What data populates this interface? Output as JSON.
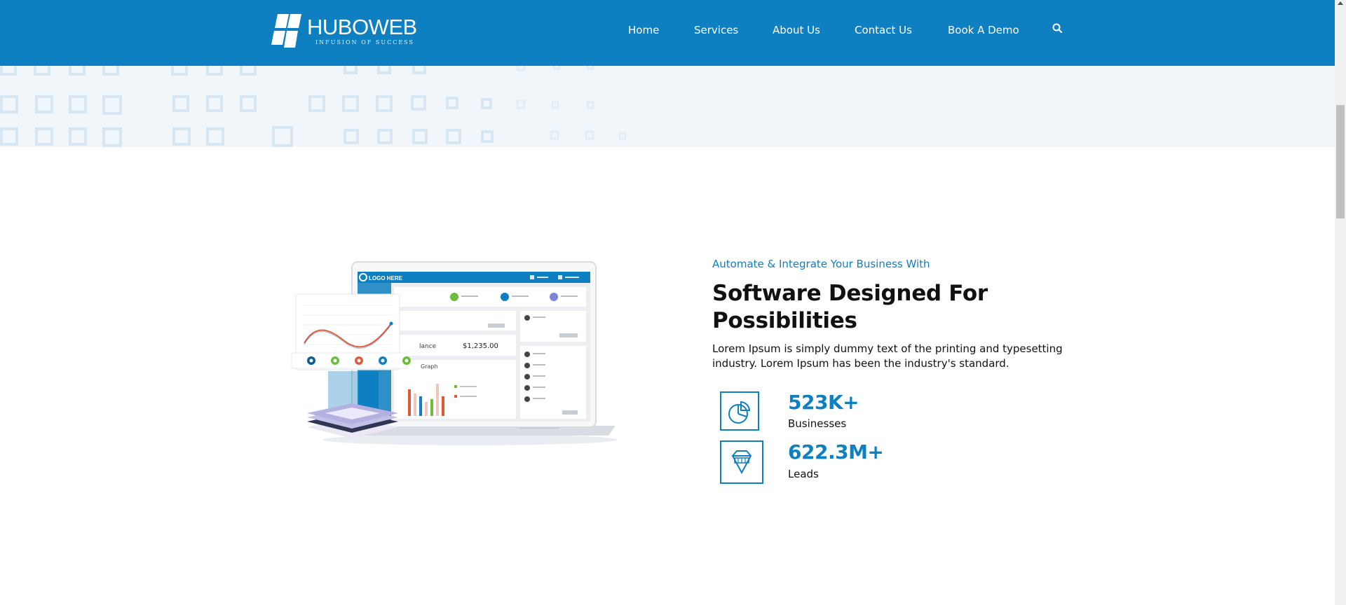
{
  "header": {
    "logo": {
      "name": "HUBOWEB",
      "tagline": "INFUSION OF SUCCESS"
    },
    "nav": [
      {
        "label": "Home"
      },
      {
        "label": "Services"
      },
      {
        "label": "About Us"
      },
      {
        "label": "Contact Us"
      },
      {
        "label": "Book A Demo"
      }
    ],
    "search_icon": "search-icon",
    "colors": {
      "bar": "#0e7fc0",
      "text": "#ffffff"
    }
  },
  "illustration": {
    "dashboard_logo": "LOGO HERE",
    "balance_label": "lance",
    "balance_value": "$1,235.00",
    "graph_label": "Graph"
  },
  "main": {
    "eyebrow": "Automate & Integrate Your Business With",
    "headline_line1": "Software Designed For",
    "headline_line2": "Possibilities",
    "description": "Lorem Ipsum is simply dummy text of the printing and typesetting industry. Lorem Ipsum has been the industry's standard.",
    "stats": [
      {
        "value": "523K+",
        "label": "Businesses",
        "icon": "pie-chart-icon"
      },
      {
        "value": "622.3M+",
        "label": "Leads",
        "icon": "diamond-icon"
      }
    ],
    "accent_color": "#0e7fc0"
  }
}
